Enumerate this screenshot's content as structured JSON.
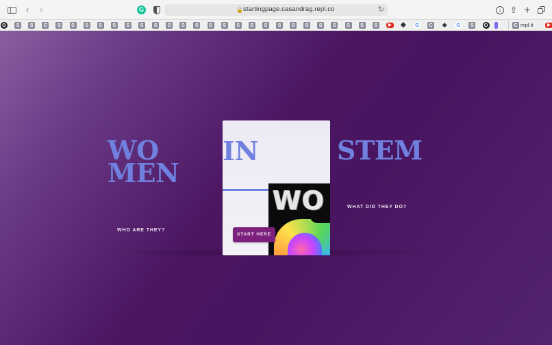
{
  "browser": {
    "url": "startingpage.casandrag.repl.co",
    "icons": {
      "sidebar": "sidebar-icon",
      "back": "chevron-left-icon",
      "forward": "chevron-right-icon",
      "extension": "grammarly-icon",
      "privacy": "shield-icon",
      "lock": "lock-icon",
      "reload": "reload-icon",
      "download": "download-icon",
      "share": "share-icon",
      "new_tab": "plus-icon",
      "tabs": "tab-overview-icon"
    },
    "glyphs": {
      "back": "‹",
      "forward": "›",
      "grammarly": "G",
      "lock": "🔒",
      "reload": "↻",
      "download": "↓",
      "share": "⇪",
      "new_tab": "+"
    }
  },
  "favorites": {
    "items": [
      {
        "icon": "d",
        "label": "⊙"
      },
      {
        "icon": "s",
        "label": "S"
      },
      {
        "icon": "s",
        "label": "S"
      },
      {
        "icon": "c",
        "label": "C"
      },
      {
        "icon": "s",
        "label": "S"
      },
      {
        "icon": "s",
        "label": "S"
      },
      {
        "icon": "s",
        "label": "S"
      },
      {
        "icon": "s",
        "label": "S"
      },
      {
        "icon": "s",
        "label": "S"
      },
      {
        "icon": "s",
        "label": "S"
      },
      {
        "icon": "s",
        "label": "S"
      },
      {
        "icon": "s",
        "label": "S"
      },
      {
        "icon": "s",
        "label": "S"
      },
      {
        "icon": "s",
        "label": "S"
      },
      {
        "icon": "s",
        "label": "S"
      },
      {
        "icon": "s",
        "label": "S"
      },
      {
        "icon": "s",
        "label": "S"
      },
      {
        "icon": "s",
        "label": "S"
      },
      {
        "icon": "s",
        "label": "S"
      },
      {
        "icon": "s",
        "label": "S"
      },
      {
        "icon": "s",
        "label": "S"
      },
      {
        "icon": "s",
        "label": "S"
      },
      {
        "icon": "s",
        "label": "S"
      },
      {
        "icon": "s",
        "label": "S"
      },
      {
        "icon": "s",
        "label": "S"
      },
      {
        "icon": "s",
        "label": "S"
      },
      {
        "icon": "s",
        "label": "S"
      },
      {
        "icon": "s",
        "label": "S"
      },
      {
        "icon": "yt",
        "label": "▶"
      },
      {
        "icon": "cp",
        "label": "◈"
      },
      {
        "icon": "g",
        "label": "G"
      },
      {
        "icon": "c",
        "label": "C"
      },
      {
        "icon": "cx",
        "label": "❖"
      },
      {
        "icon": "g",
        "label": "G"
      },
      {
        "icon": "s",
        "label": "S"
      },
      {
        "icon": "d",
        "label": "⊙"
      },
      {
        "icon": "v",
        "label": ""
      }
    ],
    "tab": {
      "label": "repl.it",
      "icon": "C"
    },
    "overflow_icon": "▶"
  },
  "hero": {
    "word_1_top": "WO",
    "word_1_bottom": "MEN",
    "word_2": "IN",
    "word_3": "STEM",
    "question_1": "WHO ARE THEY?",
    "question_2": "WHAT DID THEY DO?",
    "start_button": "START HERE",
    "artwork_text": "WO"
  },
  "colors": {
    "accent_text": "#6f80de",
    "button": "#7d1f7d",
    "background": "#4b1560"
  }
}
